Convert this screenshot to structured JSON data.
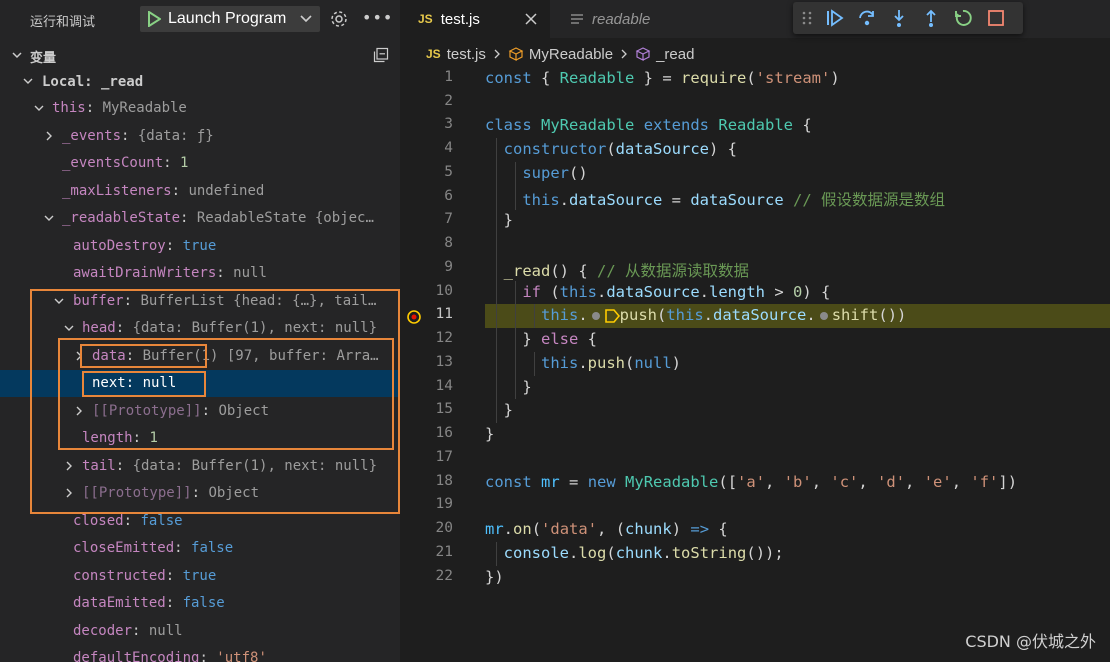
{
  "debug_panel": {
    "title": "运行和调试",
    "launch_config": "Launch Program",
    "variables_header": "变量",
    "scope_label": "Local: _read",
    "rows": [
      {
        "key": "this",
        "sep": ": ",
        "val": "MyReadable"
      },
      {
        "key": "_events",
        "sep": ": ",
        "val": "{data: ƒ}"
      },
      {
        "key": "_eventsCount",
        "sep": ": ",
        "val": "1"
      },
      {
        "key": "_maxListeners",
        "sep": ": ",
        "val": "undefined"
      },
      {
        "key": "_readableState",
        "sep": ": ",
        "val": "ReadableState {objec…"
      },
      {
        "key": "autoDestroy",
        "sep": ": ",
        "val": "true"
      },
      {
        "key": "awaitDrainWriters",
        "sep": ": ",
        "val": "null"
      },
      {
        "key": "buffer",
        "sep": ": ",
        "val": "BufferList {head: {…}, tail…"
      },
      {
        "key": "head",
        "sep": ": ",
        "val": "{data: Buffer(1), next: null}"
      },
      {
        "key": "data",
        "sep": ": ",
        "val": "Buffer(1) [97, buffer: Arra…"
      },
      {
        "key": "next",
        "sep": ": ",
        "val": "null"
      },
      {
        "key": "[[Prototype]]",
        "sep": ": ",
        "val": "Object"
      },
      {
        "key": "length",
        "sep": ": ",
        "val": "1"
      },
      {
        "key": "tail",
        "sep": ": ",
        "val": "{data: Buffer(1), next: null}"
      },
      {
        "key": "[[Prototype]]",
        "sep": ": ",
        "val": "Object"
      },
      {
        "key": "closed",
        "sep": ": ",
        "val": "false"
      },
      {
        "key": "closeEmitted",
        "sep": ": ",
        "val": "false"
      },
      {
        "key": "constructed",
        "sep": ": ",
        "val": "true"
      },
      {
        "key": "dataEmitted",
        "sep": ": ",
        "val": "false"
      },
      {
        "key": "decoder",
        "sep": ": ",
        "val": "null"
      },
      {
        "key": "defaultEncoding",
        "sep": ": ",
        "val": "'utf8'"
      }
    ]
  },
  "editor": {
    "tabs": [
      {
        "icon": "JS",
        "label": "test.js"
      },
      {
        "icon": "≡",
        "label": "readable"
      }
    ],
    "breadcrumb": {
      "file_icon": "JS",
      "file": "test.js",
      "class": "MyReadable",
      "method": "_read"
    },
    "line_numbers": [
      "1",
      "2",
      "3",
      "4",
      "5",
      "6",
      "7",
      "8",
      "9",
      "10",
      "11",
      "12",
      "13",
      "14",
      "15",
      "16",
      "17",
      "18",
      "19",
      "20",
      "21",
      "22"
    ],
    "current_line": "11"
  },
  "watermark": "CSDN @伏城之外",
  "colors": {
    "highlight_border": "#e8863a",
    "current_line_bg": "#4b4b18",
    "selected_row_bg": "#04395e"
  }
}
